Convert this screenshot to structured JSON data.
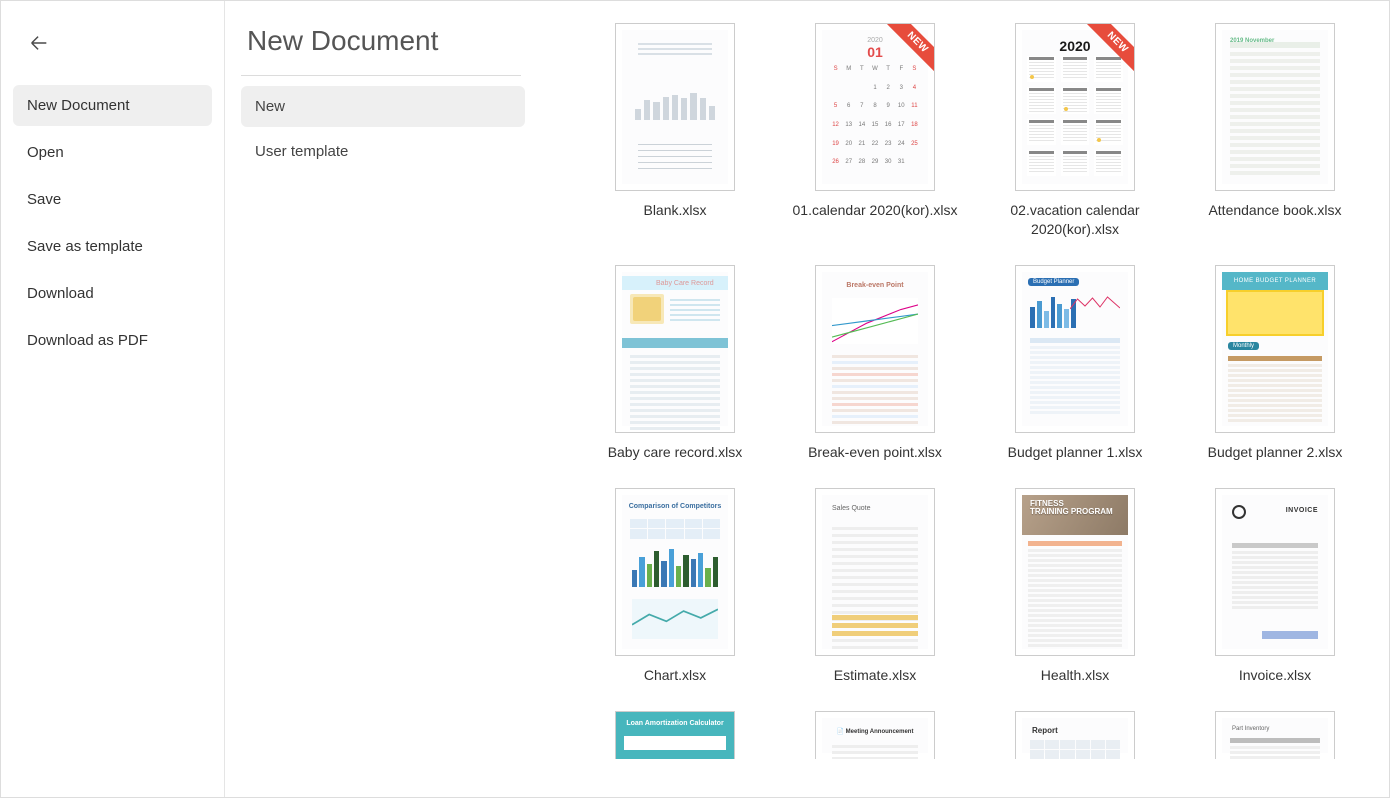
{
  "page_title": "New Document",
  "new_badge_text": "NEW",
  "rail": {
    "items": [
      {
        "label": "New Document",
        "selected": true
      },
      {
        "label": "Open"
      },
      {
        "label": "Save"
      },
      {
        "label": "Save as template"
      },
      {
        "label": "Download"
      },
      {
        "label": "Download as PDF"
      }
    ]
  },
  "subnav": {
    "items": [
      {
        "label": "New",
        "selected": true
      },
      {
        "label": "User template"
      }
    ]
  },
  "templates": [
    {
      "label": "Blank.xlsx",
      "kind": "blank",
      "new": false
    },
    {
      "label": "01.calendar 2020(kor).xlsx",
      "kind": "cal-month",
      "new": true,
      "month": "01",
      "year_small": "2020"
    },
    {
      "label": "02.vacation calendar 2020(kor).xlsx",
      "kind": "cal-year",
      "new": true,
      "year": "2020"
    },
    {
      "label": "Attendance book.xlsx",
      "kind": "attendance",
      "title": "2019 November"
    },
    {
      "label": "Baby care record.xlsx",
      "kind": "baby",
      "title": "Baby Care Record"
    },
    {
      "label": "Break-even point.xlsx",
      "kind": "bep",
      "title": "Break-even Point"
    },
    {
      "label": "Budget planner 1.xlsx",
      "kind": "budget1",
      "chip": "Budget Planner"
    },
    {
      "label": "Budget planner 2.xlsx",
      "kind": "budget2",
      "top": "HOME BUDGET PLANNER",
      "chip": "Monthly"
    },
    {
      "label": "Chart.xlsx",
      "kind": "chart",
      "title": "Comparison of Competitors"
    },
    {
      "label": "Estimate.xlsx",
      "kind": "estimate",
      "title": "Sales Quote"
    },
    {
      "label": "Health.xlsx",
      "kind": "health",
      "hero_line1": "FITNESS",
      "hero_line2": "TRAINING PROGRAM"
    },
    {
      "label": "Invoice.xlsx",
      "kind": "invoice",
      "title": "INVOICE"
    },
    {
      "label": "",
      "kind": "loan",
      "title": "Loan Amortization Calculator",
      "partial": true
    },
    {
      "label": "",
      "kind": "meeting",
      "title": "Meeting Announcement",
      "partial": true
    },
    {
      "label": "",
      "kind": "report",
      "title": "Report",
      "partial": true
    },
    {
      "label": "",
      "kind": "partinv",
      "title": "Part Inventory",
      "partial": true
    }
  ]
}
